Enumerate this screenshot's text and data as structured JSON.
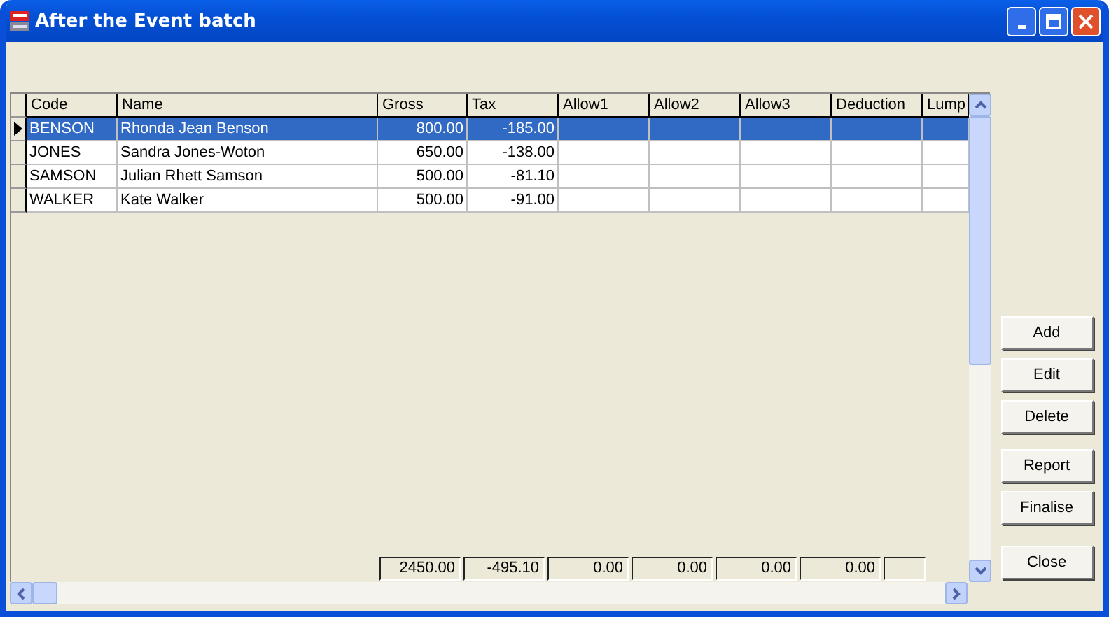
{
  "window": {
    "title": "After the Event batch"
  },
  "table": {
    "columns": [
      {
        "label": "Code",
        "kind": "text"
      },
      {
        "label": "Name",
        "kind": "text"
      },
      {
        "label": "Gross",
        "kind": "number"
      },
      {
        "label": "Tax",
        "kind": "number"
      },
      {
        "label": "Allow1",
        "kind": "number"
      },
      {
        "label": "Allow2",
        "kind": "number"
      },
      {
        "label": "Allow3",
        "kind": "number"
      },
      {
        "label": "Deduction",
        "kind": "number"
      },
      {
        "label": "Lump",
        "kind": "number"
      }
    ],
    "rows": [
      {
        "selected": true,
        "cells": [
          "BENSON",
          "Rhonda Jean Benson",
          "800.00",
          "-185.00"
        ]
      },
      {
        "selected": false,
        "cells": [
          "JONES",
          "Sandra Jones-Woton",
          "650.00",
          "-138.00"
        ]
      },
      {
        "selected": false,
        "cells": [
          "SAMSON",
          "Julian Rhett Samson",
          "500.00",
          "-81.10"
        ]
      },
      {
        "selected": false,
        "cells": [
          "WALKER",
          "Kate Walker",
          "500.00",
          "-91.00"
        ]
      }
    ],
    "totals": [
      "2450.00",
      "-495.10",
      "0.00",
      "0.00",
      "0.00",
      "0.00"
    ]
  },
  "buttons": [
    "Add",
    "Edit",
    "Delete",
    "Report",
    "Finalise",
    "Close"
  ]
}
